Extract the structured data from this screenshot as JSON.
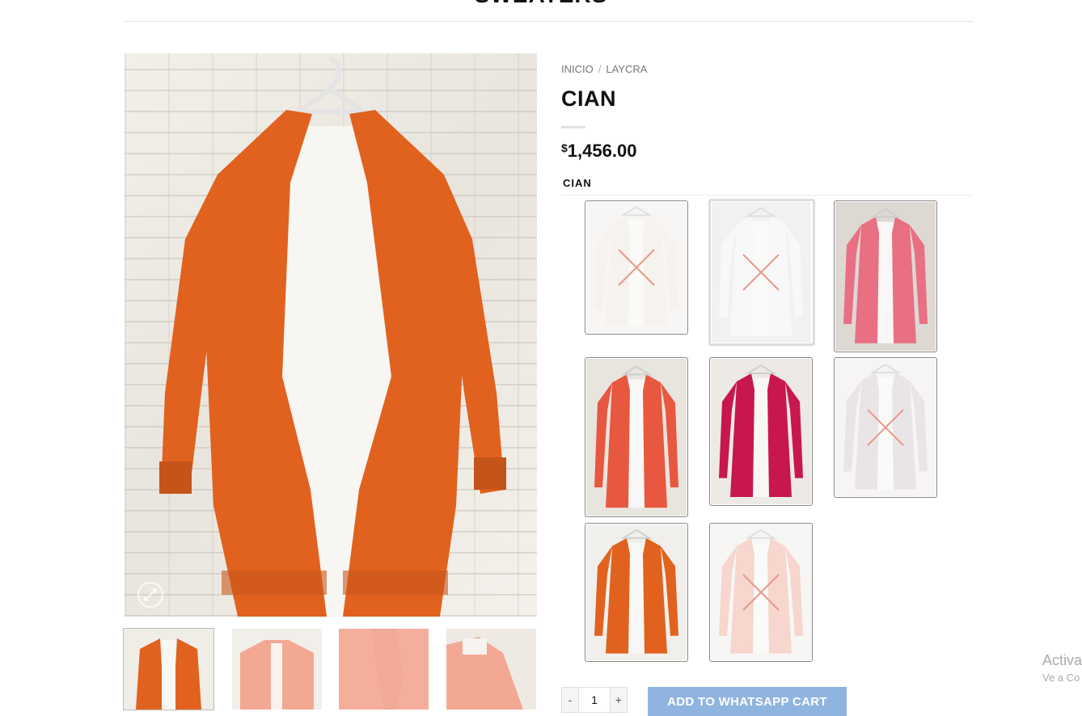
{
  "header": {
    "category_title": "SWEATERS"
  },
  "breadcrumb": {
    "home": "INICIO",
    "separator": "/",
    "category": "LAYCRA"
  },
  "product": {
    "title": "CIAN",
    "currency_symbol": "$",
    "price": "1,456.00",
    "attribute_label": "CIAN"
  },
  "swatches": [
    {
      "color": "#f1ece4",
      "bg": "#f4f2ee",
      "unavailable": true,
      "selected": false
    },
    {
      "color": "#f4f5f7",
      "bg": "#eceae6",
      "unavailable": true,
      "selected": true
    },
    {
      "color": "#e96f83",
      "bg": "#ddd8d2",
      "unavailable": false,
      "selected": false
    },
    {
      "color": "#e8573f",
      "bg": "#e8e4de",
      "unavailable": false,
      "selected": false
    },
    {
      "color": "#c8174d",
      "bg": "#ede9e4",
      "unavailable": false,
      "selected": false
    },
    {
      "color": "#ddd6dc",
      "bg": "#f2f0ed",
      "unavailable": true,
      "selected": false
    },
    {
      "color": "#e0621e",
      "bg": "#f1efeb",
      "unavailable": false,
      "selected": false
    },
    {
      "color": "#f2c0b2",
      "bg": "#f3f1ee",
      "unavailable": true,
      "selected": false
    }
  ],
  "main_image": {
    "garment_color": "#e0621e",
    "shirt_color": "#f7f6f3"
  },
  "thumbnails": [
    {
      "color": "#e0621e"
    },
    {
      "color": "#f3a893"
    },
    {
      "color": "#f0a08c"
    },
    {
      "color": "#f3a893"
    }
  ],
  "cart": {
    "quantity": "1",
    "minus_label": "-",
    "plus_label": "+",
    "button_label": "ADD TO WHATSAPP CART"
  },
  "watermark": {
    "line1": "Activa",
    "line2": "Ve a Co"
  }
}
